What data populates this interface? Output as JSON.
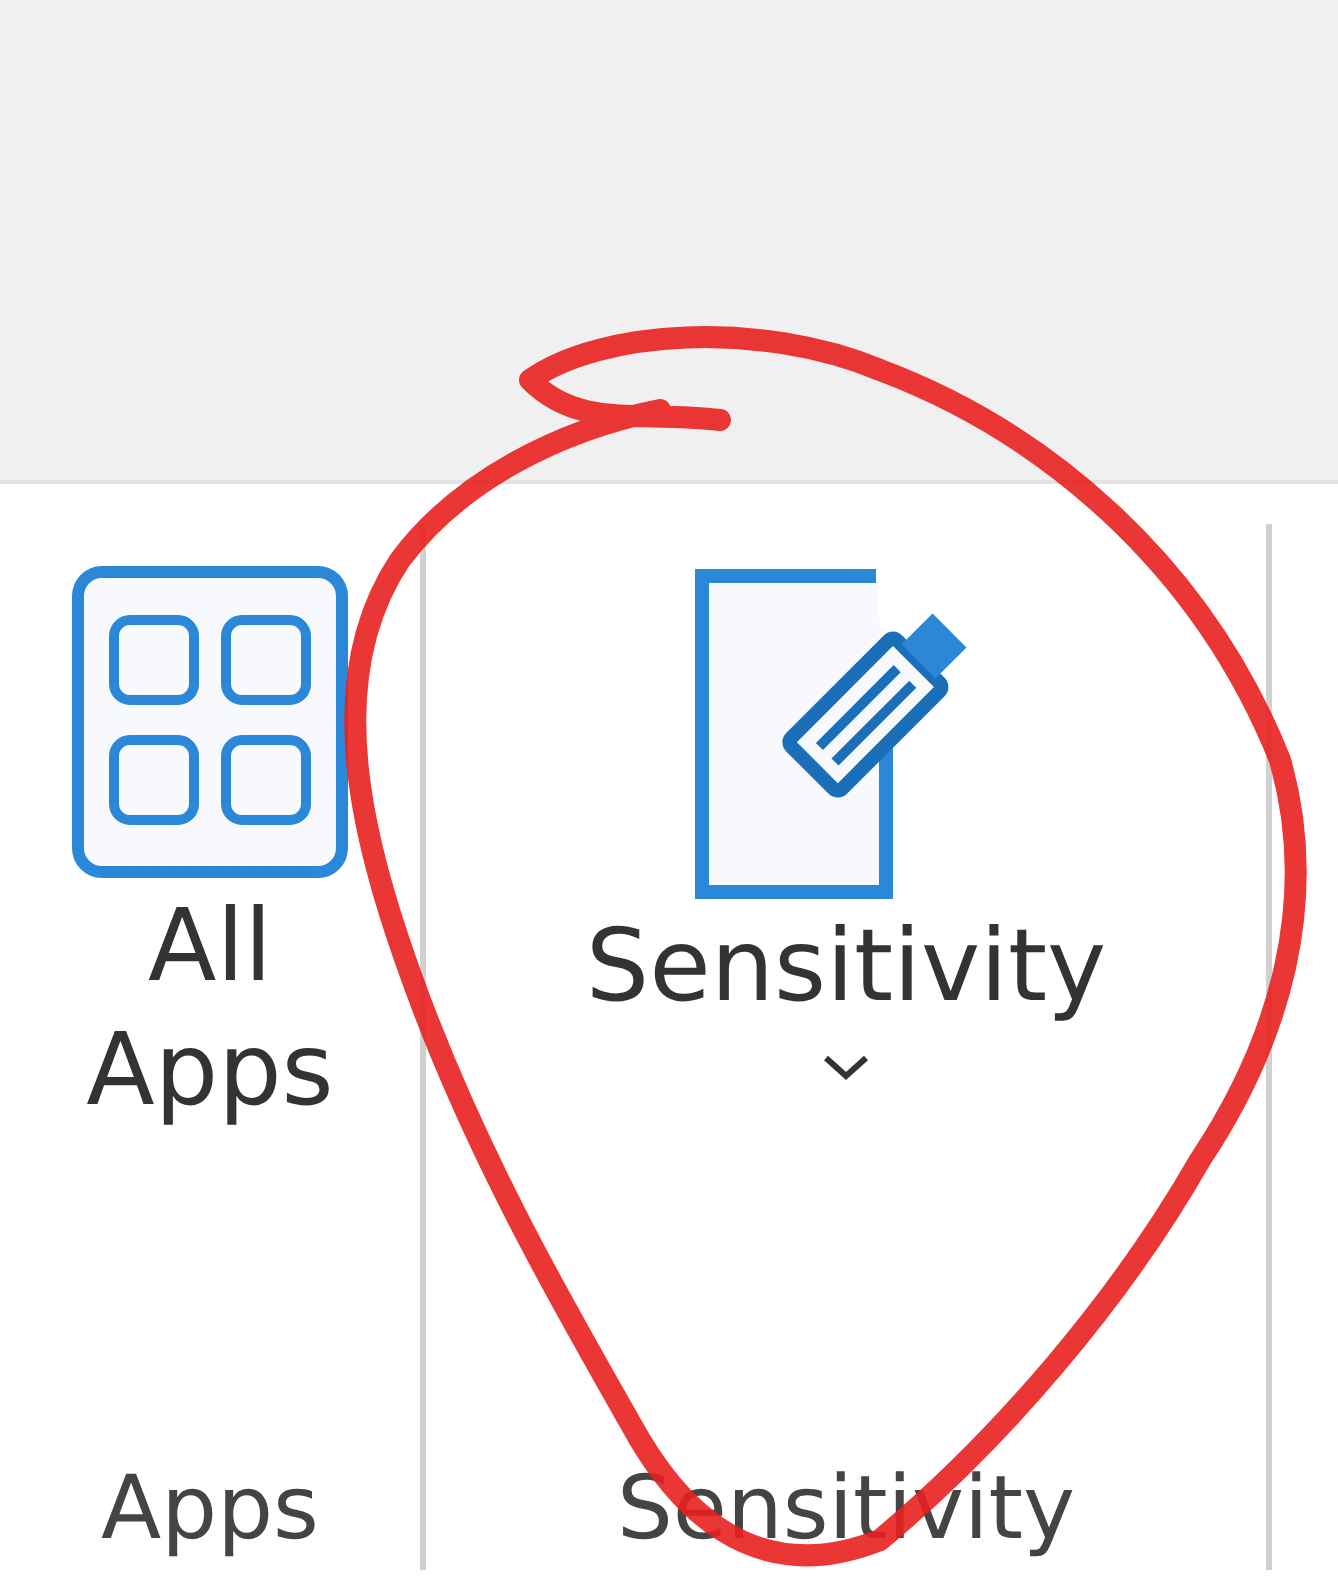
{
  "ribbon": {
    "groups": [
      {
        "label": "Apps",
        "buttons": [
          {
            "label": "All Apps",
            "kind": "grid",
            "dropdown": false
          }
        ]
      },
      {
        "label": "Sensitivity",
        "buttons": [
          {
            "label": "Sensitivity",
            "kind": "sensitivity",
            "dropdown": true
          }
        ]
      }
    ]
  },
  "annotation": {
    "kind": "circle"
  }
}
